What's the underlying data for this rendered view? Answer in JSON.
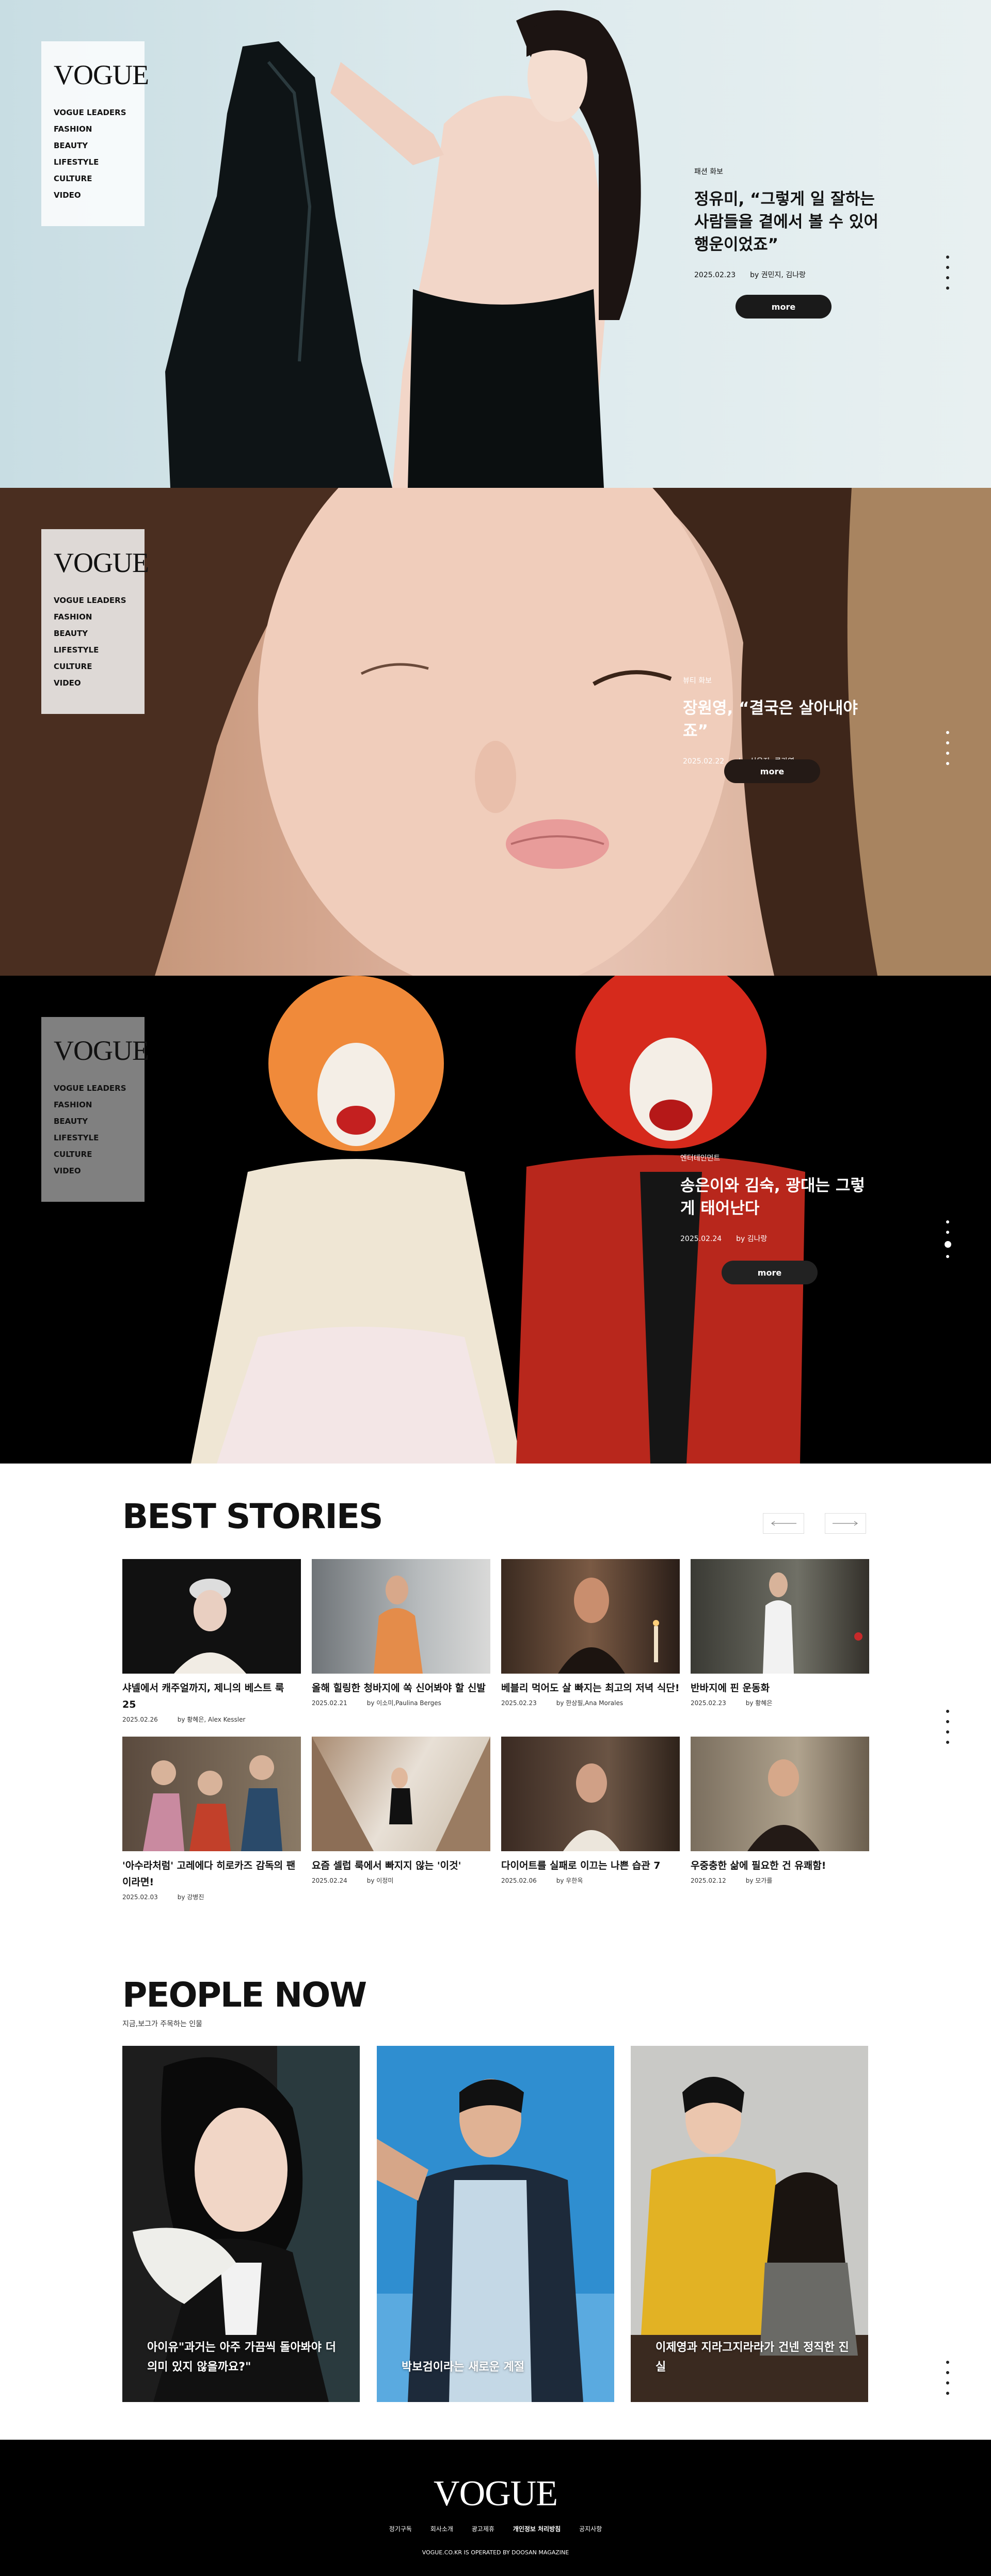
{
  "brand": "VOGUE",
  "nav": [
    "VOGUE LEADERS",
    "FASHION",
    "BEAUTY",
    "LIFESTYLE",
    "CULTURE",
    "VIDEO"
  ],
  "heroes": [
    {
      "category": "패션 화보",
      "title": "정유미, “그렇게 일 잘하는 사람들을 곁에서 볼 수 있어 행운이었죠”",
      "date": "2025.02.23",
      "byline": "by 권민지, 김나랑",
      "more": "more"
    },
    {
      "category": "뷰티 화보",
      "title": "장원영, “결국은 살아내야죠”",
      "date": "2025.02.22",
      "byline": "by 신은지, 류가영",
      "more": "more"
    },
    {
      "category": "엔터테인먼트",
      "title": "송은이와 김숙, 광대는 그렇게 태어난다",
      "date": "2025.02.24",
      "byline": "by 김나랑",
      "more": "more"
    }
  ],
  "best": {
    "title": "BEST STORIES",
    "prev_icon": "arrow-left-icon",
    "next_icon": "arrow-right-icon",
    "cards": [
      {
        "title": "샤넬에서 캐주얼까지, 제니의 베스트 룩 25",
        "date": "2025.02.26",
        "byline": "by 황혜은, Alex Kessler"
      },
      {
        "title": "올해 힐링한 청바지에 쏙 신어봐야 할 신발",
        "date": "2025.02.21",
        "byline": "by 이소미,Paulina Berges"
      },
      {
        "title": "베블리 먹어도 살 빠지는 최고의 저녁 식단!",
        "date": "2025.02.23",
        "byline": "by 한상필,Ana Morales"
      },
      {
        "title": "반바지에 핀 운동화",
        "date": "2025.02.23",
        "byline": "by 황혜은"
      },
      {
        "title": "'아수라처럼' 고레에다 히로카즈 감독의 팬이라면!",
        "date": "2025.02.03",
        "byline": "by 강병진"
      },
      {
        "title": "요즘 셀럽 룩에서 빠지지 않는 '이것'",
        "date": "2025.02.24",
        "byline": "by 이정미"
      },
      {
        "title": "다이어트를 실패로 이끄는 나쁜 습관 7",
        "date": "2025.02.06",
        "byline": "by 우한옥"
      },
      {
        "title": "우중충한 삶에 필요한 건 유쾌함!",
        "date": "2025.02.12",
        "byline": "by 모가를"
      }
    ]
  },
  "people": {
    "title": "PEOPLE NOW",
    "subtitle": "지금,보그가 주목하는 인물",
    "cards": [
      {
        "caption": "아이유\"과거는 아주 가끔씩 돌아봐야 더 의미 있지 않을까요?\""
      },
      {
        "caption": "박보검이라는 새로운 계절"
      },
      {
        "caption": "이제영과 지라그지라라가 건넨 정직한 진실"
      }
    ]
  },
  "footer": {
    "logo": "VOGUE",
    "links": [
      "정기구독",
      "회사소개",
      "광고제휴",
      "개인정보 처리방침",
      "공지사항"
    ],
    "copyright": "VOGUE.CO.KR IS OPERATED BY DOOSAN MAGAZINE"
  },
  "colors": {
    "hero1_bg": "#d7e6ea",
    "hero3_bg": "#000000",
    "footer_bg": "#000000",
    "button": "#1a1a1a"
  }
}
